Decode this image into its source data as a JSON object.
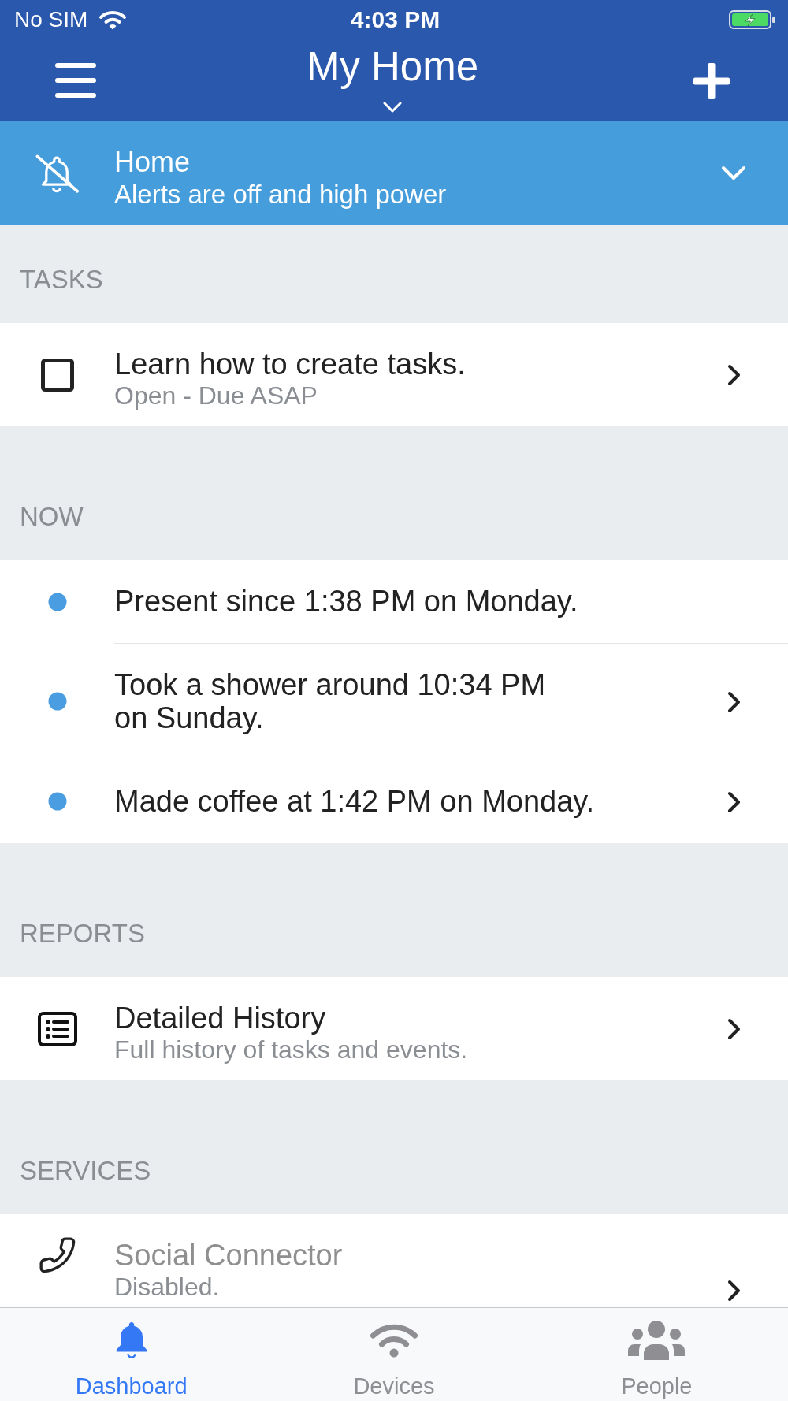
{
  "status_bar": {
    "carrier": "No SIM",
    "time": "4:03 PM"
  },
  "header": {
    "title": "My Home"
  },
  "mode_banner": {
    "title": "Home",
    "subtitle": "Alerts are off and high power"
  },
  "sections": [
    {
      "heading": "TASKS",
      "items": [
        {
          "kind": "task",
          "title": "Learn how to create tasks.",
          "subtitle": "Open - Due ASAP",
          "checked": false,
          "has_detail": true
        }
      ]
    },
    {
      "heading": "NOW",
      "items": [
        {
          "kind": "event",
          "title": "Present since 1:38 PM on Monday.",
          "has_detail": false
        },
        {
          "kind": "event",
          "title": "Took a shower around 10:34 PM\non Sunday.",
          "has_detail": true
        },
        {
          "kind": "event",
          "title": "Made coffee at 1:42 PM on Monday.",
          "has_detail": true
        }
      ]
    },
    {
      "heading": "REPORTS",
      "items": [
        {
          "kind": "report",
          "title": "Detailed History",
          "subtitle": "Full history of tasks and events.",
          "has_detail": true
        }
      ]
    },
    {
      "heading": "SERVICES",
      "items": [
        {
          "kind": "service",
          "title": "Social Connector",
          "subtitle": "Disabled.",
          "disabled": true,
          "has_detail": true
        }
      ]
    }
  ],
  "tab_bar": [
    {
      "kind": "dashboard",
      "label": "Dashboard",
      "selected": true
    },
    {
      "kind": "devices",
      "label": "Devices",
      "selected": false
    },
    {
      "kind": "people",
      "label": "People",
      "selected": false
    }
  ]
}
